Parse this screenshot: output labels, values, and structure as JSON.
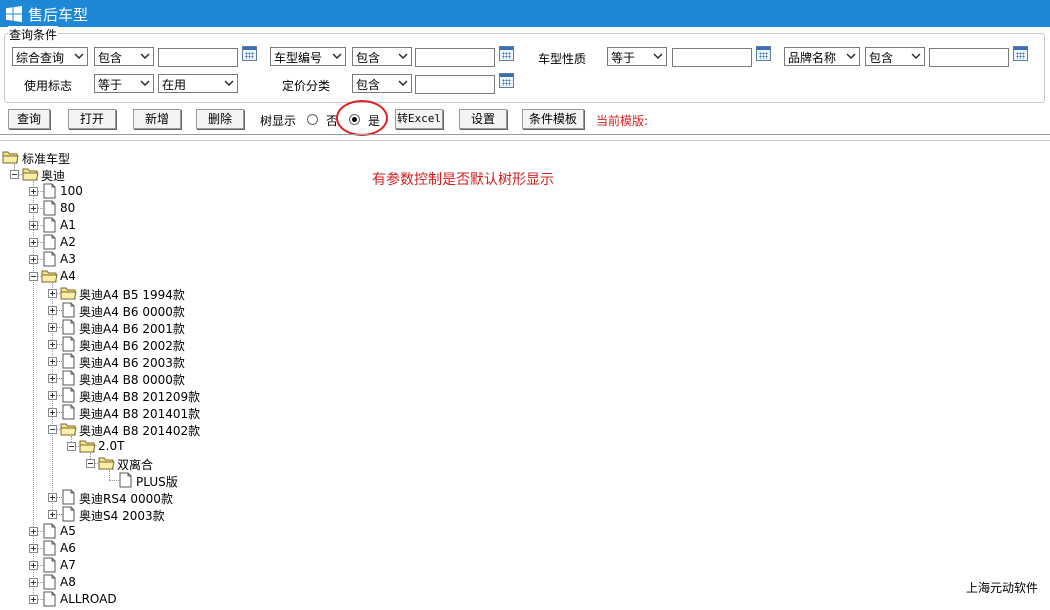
{
  "window": {
    "title": "售后车型",
    "icon": "windows-logo-icon"
  },
  "query": {
    "group_label": "查询条件",
    "row1": {
      "field1": "综合查询",
      "op1": "包含",
      "value1": "",
      "field2": "车型编号",
      "op2": "包含",
      "value2": "",
      "label3": "车型性质",
      "op3": "等于",
      "value3": "",
      "field4": "品牌名称",
      "op4": "包含",
      "value4": ""
    },
    "row2": {
      "label1": "使用标志",
      "op1": "等于",
      "value1": "在用",
      "label2": "定价分类",
      "op2": "包含",
      "value2": ""
    }
  },
  "toolbar": {
    "query": "查询",
    "open": "打开",
    "add": "新增",
    "delete": "删除",
    "tree_display_label": "树显示",
    "option_no": "否",
    "option_yes": "是",
    "tree_display_selected": "是",
    "to_excel": "转Excel",
    "settings": "设置",
    "condition_template": "条件模板",
    "current_template": "当前模版:"
  },
  "annotation": "有参数控制是否默认树形显示",
  "tree": {
    "root": "标准车型",
    "brand": "奥迪",
    "models": [
      "100",
      "80",
      "A1",
      "A2",
      "A3",
      "A4"
    ],
    "a4_children": [
      "奥迪A4 B5 1994款",
      "奥迪A4 B6 0000款",
      "奥迪A4 B6 2001款",
      "奥迪A4 B6 2002款",
      "奥迪A4 B6 2003款",
      "奥迪A4 B8 0000款",
      "奥迪A4 B8 201209款",
      "奥迪A4 B8 201401款",
      "奥迪A4 B8 201402款"
    ],
    "engine": "2.0T",
    "transmission": "双离合",
    "trim": "PLUS版",
    "a4_more": [
      "奥迪RS4 0000款",
      "奥迪S4 2003款"
    ],
    "models_more": [
      "A5",
      "A6",
      "A7",
      "A8",
      "ALLROAD"
    ]
  },
  "footer": "上海元动软件"
}
